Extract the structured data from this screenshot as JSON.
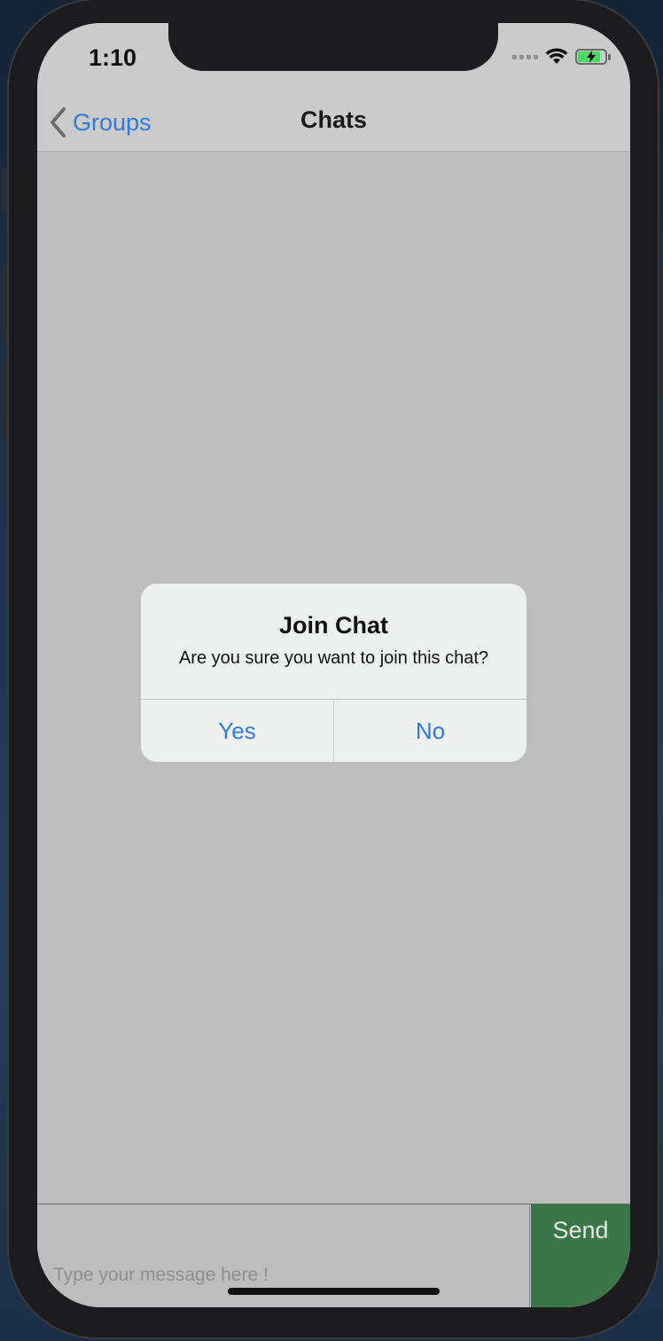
{
  "status_bar": {
    "time": "1:10",
    "battery_level": 0.78,
    "battery_color": "#4cd964",
    "icons": [
      "cellular-signal-icon",
      "wifi-icon",
      "battery-charging-icon"
    ]
  },
  "nav": {
    "back_label": "Groups",
    "title": "Chats",
    "accent_color": "#2f7bdc"
  },
  "alert": {
    "title": "Join Chat",
    "message": "Are you sure you want to join this chat?",
    "yes_label": "Yes",
    "no_label": "No"
  },
  "composer": {
    "placeholder": "Type your message here !",
    "value": "",
    "send_label": "Send",
    "send_color": "#3b7648"
  }
}
